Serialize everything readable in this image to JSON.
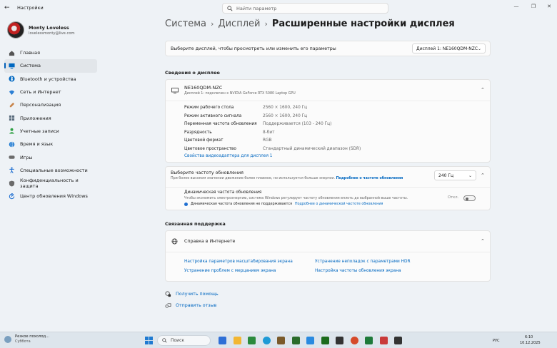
{
  "window": {
    "title": "Настройки",
    "back_glyph": "←",
    "minimize_glyph": "—",
    "maximize_glyph": "❐",
    "close_glyph": "✕"
  },
  "search": {
    "placeholder": "Найти параметр"
  },
  "profile": {
    "name": "Monty Loveless",
    "email": "lovelessmonty@live.com"
  },
  "nav": [
    {
      "label": "Главная",
      "icon": "home-icon",
      "color": "#555555"
    },
    {
      "label": "Система",
      "icon": "system-icon",
      "color": "#0067c0",
      "active": true
    },
    {
      "label": "Bluetooth и устройства",
      "icon": "bluetooth-icon",
      "color": "#0067c0"
    },
    {
      "label": "Сеть и Интернет",
      "icon": "wifi-icon",
      "color": "#2b7fd4"
    },
    {
      "label": "Персонализация",
      "icon": "brush-icon",
      "color": "#c8844a"
    },
    {
      "label": "Приложения",
      "icon": "apps-icon",
      "color": "#5a6c7c"
    },
    {
      "label": "Учетные записи",
      "icon": "account-icon",
      "color": "#2ea043"
    },
    {
      "label": "Время и язык",
      "icon": "globe-icon",
      "color": "#1f7ad1"
    },
    {
      "label": "Игры",
      "icon": "gamepad-icon",
      "color": "#6b6b6b"
    },
    {
      "label": "Специальные возможности",
      "icon": "accessibility-icon",
      "color": "#1f6fd1"
    },
    {
      "label": "Конфиденциальность и защита",
      "icon": "shield-icon",
      "color": "#6b6b6b"
    },
    {
      "label": "Центр обновления Windows",
      "icon": "update-icon",
      "color": "#1f6fd1"
    }
  ],
  "breadcrumb": {
    "part1": "Система",
    "part2": "Дисплей",
    "current": "Расширенные настройки дисплея",
    "separator": "›"
  },
  "display_select": {
    "label": "Выберите дисплей, чтобы просмотреть или изменить его параметры",
    "value": "Дисплей 1: NE160QDM-NZC"
  },
  "display_info": {
    "heading": "Сведения о дисплее",
    "name": "NE160QDM-NZC",
    "subtitle": "Дисплей 1: подключен к NVIDIA GeForce RTX 5080 Laptop GPU",
    "rows": [
      {
        "label": "Режим рабочего стола",
        "value": "2560 × 1600, 240 Гц"
      },
      {
        "label": "Режим активного сигнала",
        "value": "2560 × 1600, 240 Гц"
      },
      {
        "label": "Переменная частота обновления",
        "value": "Поддерживается (103 - 240 Гц)"
      },
      {
        "label": "Разрядность",
        "value": "8-бит"
      },
      {
        "label": "Цветовой формат",
        "value": "RGB"
      },
      {
        "label": "Цветовое пространство",
        "value": "Стандартный динамический диапазон (SDR)"
      }
    ],
    "adapter_link": "Свойства видеоадаптера для дисплея 1"
  },
  "refresh": {
    "title": "Выберите частоту обновления",
    "desc": "При более высоком значении движение более плавное, но используется больше энергии.",
    "more_link": "Подробнее о частоте обновления",
    "value": "240 Гц",
    "dynamic_title": "Динамическая частота обновления",
    "dynamic_desc": "Чтобы экономить электроэнергию, система Windows регулирует частоту обновления вплоть до выбранной выше частоты.",
    "not_supported": "Динамическая частота обновления не поддерживается",
    "dynamic_link": "Подробнее о динамической частоте обновления",
    "toggle_label": "Откл."
  },
  "support": {
    "heading": "Связанная поддержка",
    "help_title": "Справка в Интернете",
    "links": [
      "Настройка параметров масштабирования экрана",
      "Устранение неполадок с параметрами HDR",
      "Устранение проблем с мерцанием экрана",
      "Настройка частоты обновления экрана"
    ]
  },
  "footer": {
    "help": "Получить помощь",
    "feedback": "Отправить отзыв"
  },
  "taskbar": {
    "weather_title": "Резкое похолод...",
    "weather_sub": "Суббота",
    "search": "Поиск",
    "lang": "РУС",
    "time": "6:10",
    "date": "10.12.2025",
    "icon_colors": [
      "#2f6fd6",
      "#f2b632",
      "#2a8a3c",
      "#1e9ad6",
      "#7a5a2a",
      "#2a6b2a",
      "#2a8ae0",
      "#1c6b1c",
      "#333333",
      "#d64a2a",
      "#1e7a3a",
      "#c93a3a",
      "#333333"
    ]
  }
}
